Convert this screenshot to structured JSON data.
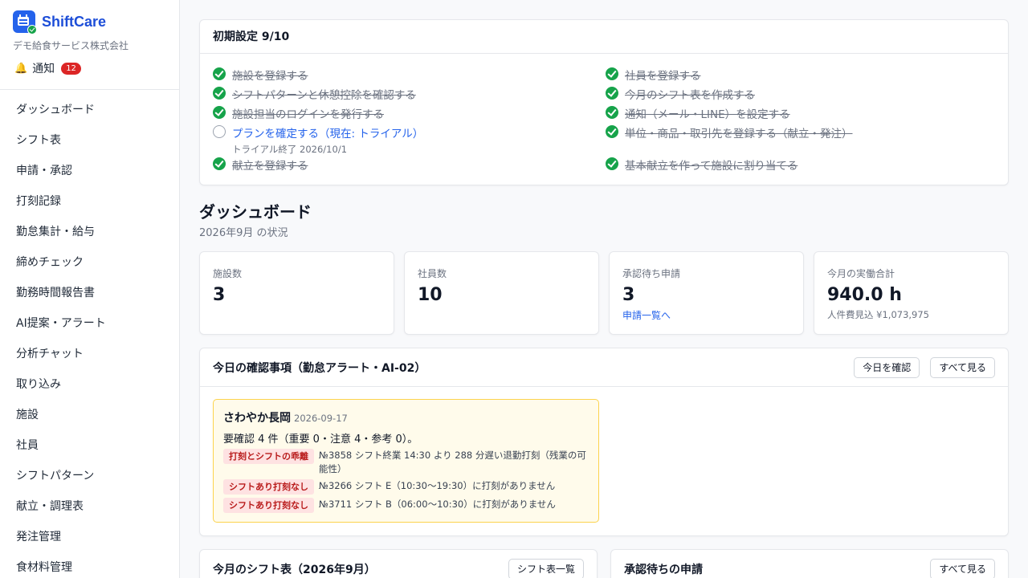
{
  "app": {
    "name": "ShiftCare",
    "company": "デモ給食サービス株式会社",
    "notification_label": "通知",
    "notification_count": "12"
  },
  "sidebar": {
    "items": [
      "ダッシュボード",
      "シフト表",
      "申請・承認",
      "打刻記録",
      "勤怠集計・給与",
      "締めチェック",
      "勤務時間報告書",
      "AI提案・アラート",
      "分析チャット",
      "取り込み",
      "施設",
      "社員",
      "シフトパターン",
      "献立・調理表",
      "発注管理",
      "食材料管理"
    ]
  },
  "setup": {
    "title": "初期設定 9/10",
    "tasks": [
      {
        "label": "施設を登録する",
        "done": true
      },
      {
        "label": "社員を登録する",
        "done": true
      },
      {
        "label": "シフトパターンと休憩控除を確認する",
        "done": true
      },
      {
        "label": "今月のシフト表を作成する",
        "done": true
      },
      {
        "label": "施設担当のログインを発行する",
        "done": true
      },
      {
        "label": "通知（メール・LINE）を設定する",
        "done": true
      },
      {
        "label": "プランを確定する（現在: トライアル）",
        "done": false,
        "sub": "トライアル終了 2026/10/1"
      },
      {
        "label": "単位・商品・取引先を登録する（献立・発注）",
        "done": true
      },
      {
        "label": "献立を登録する",
        "done": true
      },
      {
        "label": "基本献立を作って施設に割り当てる",
        "done": true
      }
    ]
  },
  "dashboard": {
    "title": "ダッシュボード",
    "subtitle": "2026年9月 の状況",
    "stats": [
      {
        "label": "施設数",
        "value": "3"
      },
      {
        "label": "社員数",
        "value": "10"
      },
      {
        "label": "承認待ち申請",
        "value": "3",
        "link": "申請一覧へ"
      },
      {
        "label": "今月の実働合計",
        "value": "940.0 h",
        "note": "人件費見込 ¥1,073,975"
      }
    ]
  },
  "alerts": {
    "title": "今日の確認事項（勤怠アラート・AI-02）",
    "check_today_button": "今日を確認",
    "see_all_button": "すべて見る",
    "facility": "さわやか長岡",
    "date": "2026-09-17",
    "summary": "要確認 4 件（重要 0・注意 4・参考 0）。",
    "rows": [
      {
        "tag": "打刻とシフトの乖離",
        "text": "№3858 シフト終業 14:30 より 288 分遅い退勤打刻（残業の可能性）"
      },
      {
        "tag": "シフトあり打刻なし",
        "text": "№3266 シフト E（10:30〜19:30）に打刻がありません"
      },
      {
        "tag": "シフトあり打刻なし",
        "text": "№3711 シフト B（06:00〜10:30）に打刻がありません"
      }
    ]
  },
  "shift_card": {
    "title": "今月のシフト表（2026年9月）",
    "button": "シフト表一覧"
  },
  "pending_card": {
    "title": "承認待ちの申請",
    "button": "すべて見る"
  }
}
